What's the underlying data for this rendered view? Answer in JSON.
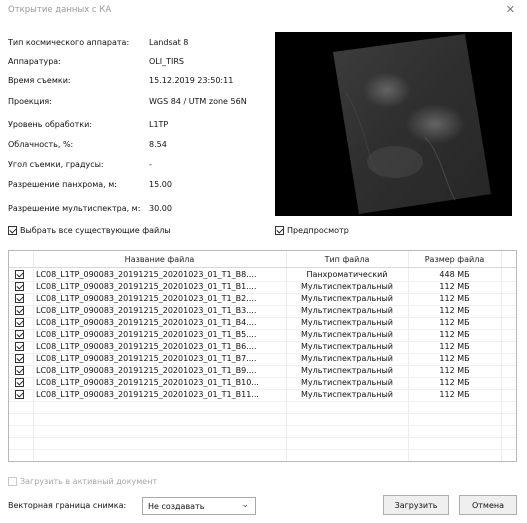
{
  "window": {
    "title": "Открытие данных с КА",
    "close_glyph": "✕"
  },
  "info": [
    {
      "label": "Тип космического аппарата:",
      "value": "Landsat 8"
    },
    {
      "label": "Аппаратура:",
      "value": "OLI_TIRS"
    },
    {
      "label": "Время съемки:",
      "value": "15.12.2019 23:50:11"
    },
    {
      "label": "Проекция:",
      "value": "WGS 84 / UTM zone 56N"
    },
    {
      "label": "Уровень обработки:",
      "value": "L1TP"
    },
    {
      "label": "Облачность, %:",
      "value": "8.54"
    },
    {
      "label": "Угол съемки, градусы:",
      "value": "-"
    },
    {
      "label": "Разрешение панхрома, м:",
      "value": "15.00"
    },
    {
      "label": "Разрешение мультиспектра, м:",
      "value": "30.00"
    }
  ],
  "select_all_label": "Выбрать все существующие файлы",
  "select_all_checked": true,
  "preview_label": "Предпросмотр",
  "preview_checked": true,
  "table": {
    "headers": {
      "name": "Название файла",
      "type": "Тип файла",
      "size": "Размер файла"
    },
    "rows": [
      {
        "name": "LC08_L1TP_090083_20191215_20201023_01_T1_B8....",
        "type": "Панхроматический",
        "size": "448 МБ",
        "checked": true
      },
      {
        "name": "LC08_L1TP_090083_20191215_20201023_01_T1_B1....",
        "type": "Мультиспектральный",
        "size": "112 МБ",
        "checked": true
      },
      {
        "name": "LC08_L1TP_090083_20191215_20201023_01_T1_B2....",
        "type": "Мультиспектральный",
        "size": "112 МБ",
        "checked": true
      },
      {
        "name": "LC08_L1TP_090083_20191215_20201023_01_T1_B3....",
        "type": "Мультиспектральный",
        "size": "112 МБ",
        "checked": true
      },
      {
        "name": "LC08_L1TP_090083_20191215_20201023_01_T1_B4....",
        "type": "Мультиспектральный",
        "size": "112 МБ",
        "checked": true
      },
      {
        "name": "LC08_L1TP_090083_20191215_20201023_01_T1_B5....",
        "type": "Мультиспектральный",
        "size": "112 МБ",
        "checked": true
      },
      {
        "name": "LC08_L1TP_090083_20191215_20201023_01_T1_B6....",
        "type": "Мультиспектральный",
        "size": "112 МБ",
        "checked": true
      },
      {
        "name": "LC08_L1TP_090083_20191215_20201023_01_T1_B7....",
        "type": "Мультиспектральный",
        "size": "112 МБ",
        "checked": true
      },
      {
        "name": "LC08_L1TP_090083_20191215_20201023_01_T1_B9....",
        "type": "Мультиспектральный",
        "size": "112 МБ",
        "checked": true
      },
      {
        "name": "LC08_L1TP_090083_20191215_20201023_01_T1_B10...",
        "type": "Мультиспектральный",
        "size": "112 МБ",
        "checked": true
      },
      {
        "name": "LC08_L1TP_090083_20191215_20201023_01_T1_B11...",
        "type": "Мультиспектральный",
        "size": "112 МБ",
        "checked": true
      }
    ]
  },
  "load_active_label": "Загрузить в активный документ",
  "load_active_checked": false,
  "vector_border_label": "Векторная граница снимка:",
  "vector_border_value": "Не создавать",
  "buttons": {
    "load": "Загрузить",
    "cancel": "Отмена"
  }
}
